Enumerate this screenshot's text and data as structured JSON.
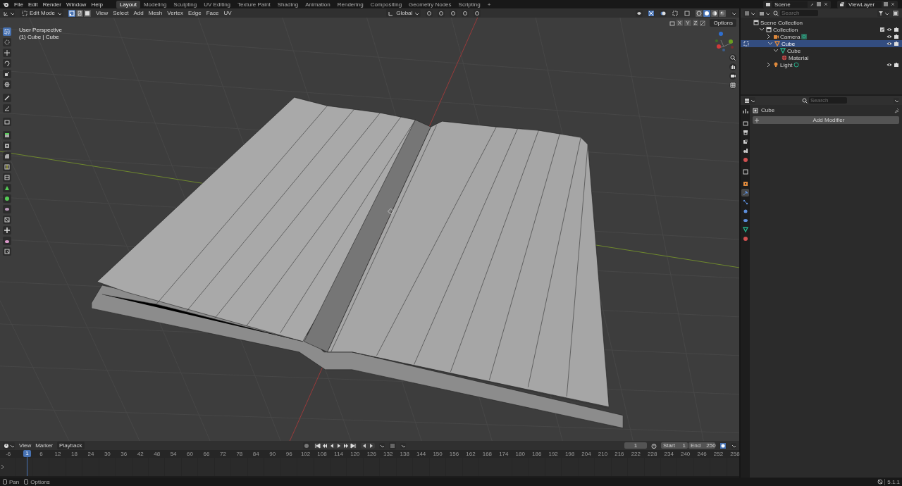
{
  "top_bar": {
    "menus": [
      "File",
      "Edit",
      "Render",
      "Window",
      "Help"
    ],
    "workspaces": [
      {
        "label": "Layout",
        "selected": true
      },
      {
        "label": "Modeling",
        "selected": false
      },
      {
        "label": "Sculpting",
        "selected": false
      },
      {
        "label": "UV Editing",
        "selected": false
      },
      {
        "label": "Texture Paint",
        "selected": false
      },
      {
        "label": "Shading",
        "selected": false
      },
      {
        "label": "Animation",
        "selected": false
      },
      {
        "label": "Rendering",
        "selected": false
      },
      {
        "label": "Compositing",
        "selected": false
      },
      {
        "label": "Geometry Nodes",
        "selected": false
      },
      {
        "label": "Scripting",
        "selected": false
      }
    ],
    "add_workspace": "+",
    "scene": "Scene",
    "view_layer": "ViewLayer"
  },
  "viewport": {
    "mode": "Edit Mode",
    "select_modes": [
      {
        "selected": true
      },
      {
        "selected": false
      },
      {
        "selected": false
      }
    ],
    "menus": [
      "View",
      "Select",
      "Add",
      "Mesh",
      "Vertex",
      "Edge",
      "Face",
      "UV"
    ],
    "orientation": "Global",
    "shading_modes": [
      {
        "selected": false
      },
      {
        "selected": true
      },
      {
        "selected": false
      },
      {
        "selected": false
      }
    ],
    "mirror_axes": [
      "X",
      "Y",
      "Z"
    ],
    "options": "Options",
    "view_name": "User Perspective",
    "object_info": "(1) Cube | Cube",
    "tools": [
      {
        "selected": true
      },
      {
        "selected": false
      },
      {
        "selected": false
      },
      {
        "selected": false
      },
      {
        "selected": false
      },
      {
        "selected": false
      },
      {
        "selected": false
      },
      {
        "selected": false
      },
      {
        "selected": false
      },
      {
        "selected": false
      },
      {
        "selected": false
      },
      {
        "selected": false
      },
      {
        "selected": false
      },
      {
        "selected": false
      },
      {
        "selected": false
      },
      {
        "selected": false
      },
      {
        "selected": false
      },
      {
        "selected": false
      },
      {
        "selected": false
      },
      {
        "selected": false
      },
      {
        "selected": false
      }
    ]
  },
  "outliner": {
    "search_placeholder": "Search",
    "items": [
      {
        "label": "Scene Collection",
        "kind": "scene",
        "selected": false,
        "children": [
          {
            "label": "Collection",
            "kind": "collection",
            "selected": false,
            "expanded": true,
            "children": [
              {
                "label": "Camera",
                "kind": "camera",
                "selected": false,
                "expanded": false
              },
              {
                "label": "Cube",
                "kind": "object",
                "selected": true,
                "expanded": true,
                "children": [
                  {
                    "label": "Cube",
                    "kind": "mesh",
                    "selected": false,
                    "expanded": true,
                    "children": [
                      {
                        "label": "Material",
                        "kind": "material",
                        "selected": false
                      }
                    ]
                  }
                ]
              },
              {
                "label": "Light",
                "kind": "light",
                "selected": false,
                "expanded": false
              }
            ]
          }
        ]
      }
    ]
  },
  "properties": {
    "search_placeholder": "Search",
    "tabs": [
      {
        "selected": false
      },
      {
        "selected": false
      },
      {
        "selected": false
      },
      {
        "selected": false
      },
      {
        "selected": false
      },
      {
        "selected": false
      },
      {
        "selected": false
      },
      {
        "selected": false
      },
      {
        "selected": true
      },
      {
        "selected": false
      },
      {
        "selected": false
      },
      {
        "selected": false
      },
      {
        "selected": false
      },
      {
        "selected": false
      }
    ],
    "object_name": "Cube",
    "add_modifier": "Add Modifier"
  },
  "timeline": {
    "menus": [
      "View",
      "Marker",
      "Playback"
    ],
    "current_frame": "1",
    "start_label": "Start",
    "start": "1",
    "end_label": "End",
    "end": "250",
    "playhead": "1",
    "ruler": [
      "-6",
      "6",
      "12",
      "18",
      "24",
      "30",
      "36",
      "42",
      "48",
      "54",
      "60",
      "66",
      "72",
      "78",
      "84",
      "90",
      "96",
      "102",
      "108",
      "114",
      "120",
      "126",
      "132",
      "138",
      "144",
      "150",
      "156",
      "162",
      "168",
      "174",
      "180",
      "186",
      "192",
      "198",
      "204",
      "210",
      "216",
      "222",
      "228",
      "234",
      "240",
      "246",
      "252",
      "258"
    ]
  },
  "status_bar": {
    "hints": [
      "Pan",
      "Options"
    ],
    "version": "5.1.1"
  }
}
